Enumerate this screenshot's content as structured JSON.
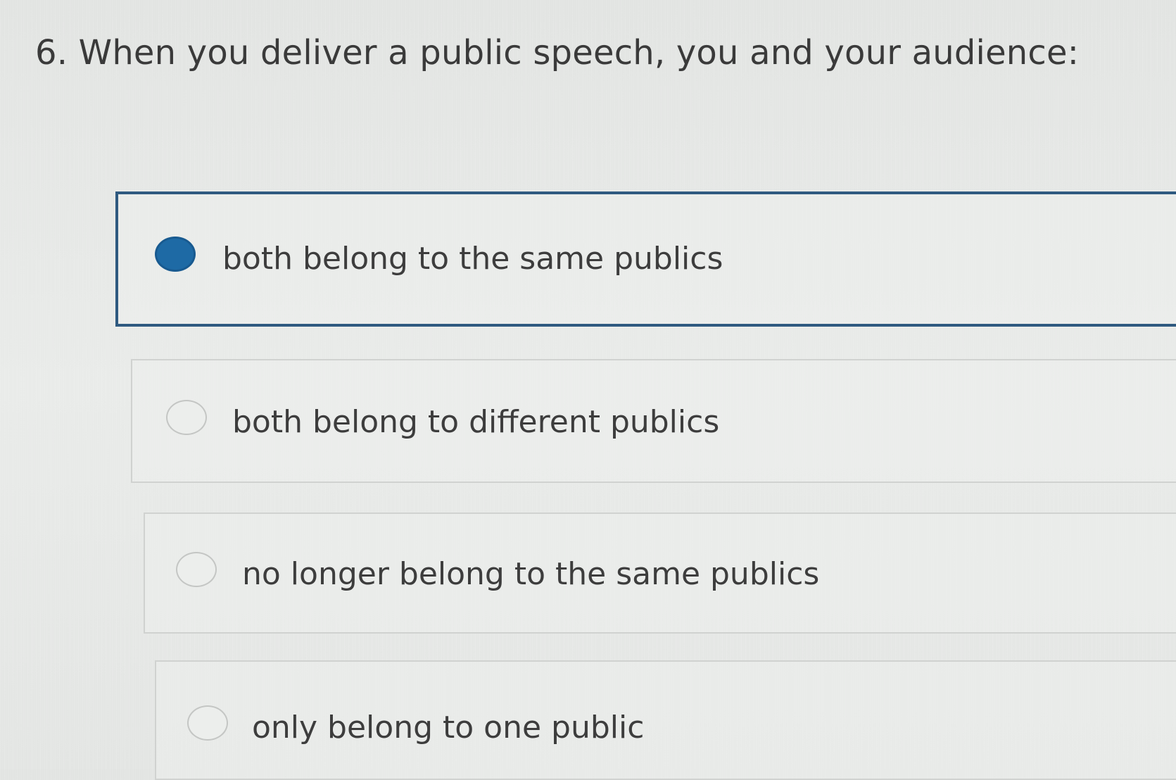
{
  "question": {
    "text": "6. When you deliver a public speech, you and your audience:"
  },
  "choices": [
    {
      "label": "both belong to the same publics",
      "selected": true
    },
    {
      "label": "both belong to different publics",
      "selected": false
    },
    {
      "label": "no longer belong to the same publics",
      "selected": false
    },
    {
      "label": "only belong to one public",
      "selected": false
    }
  ],
  "colors": {
    "selected_border": "#2f5a80",
    "radio_selected": "#1e6aa5",
    "background": "#e6e8e6"
  }
}
